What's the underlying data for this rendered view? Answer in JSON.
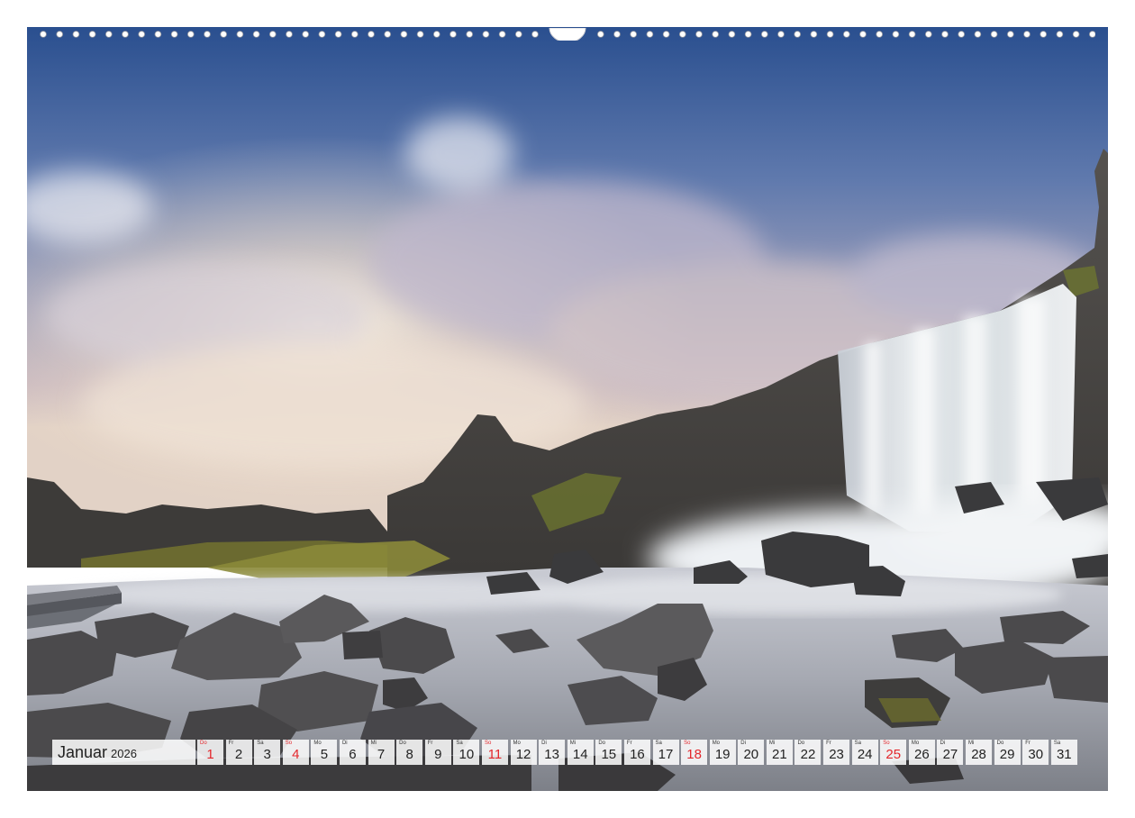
{
  "calendar": {
    "month": "Januar",
    "year": "2026",
    "sunday_color": "#e3262b",
    "days": [
      {
        "wd": "Do",
        "n": "1",
        "sun": true
      },
      {
        "wd": "Fr",
        "n": "2",
        "sun": false
      },
      {
        "wd": "Sa",
        "n": "3",
        "sun": false
      },
      {
        "wd": "So",
        "n": "4",
        "sun": true
      },
      {
        "wd": "Mo",
        "n": "5",
        "sun": false
      },
      {
        "wd": "Di",
        "n": "6",
        "sun": false
      },
      {
        "wd": "Mi",
        "n": "7",
        "sun": false
      },
      {
        "wd": "Do",
        "n": "8",
        "sun": false
      },
      {
        "wd": "Fr",
        "n": "9",
        "sun": false
      },
      {
        "wd": "Sa",
        "n": "10",
        "sun": false
      },
      {
        "wd": "So",
        "n": "11",
        "sun": true
      },
      {
        "wd": "Mo",
        "n": "12",
        "sun": false
      },
      {
        "wd": "Di",
        "n": "13",
        "sun": false
      },
      {
        "wd": "Mi",
        "n": "14",
        "sun": false
      },
      {
        "wd": "Do",
        "n": "15",
        "sun": false
      },
      {
        "wd": "Fr",
        "n": "16",
        "sun": false
      },
      {
        "wd": "Sa",
        "n": "17",
        "sun": false
      },
      {
        "wd": "So",
        "n": "18",
        "sun": true
      },
      {
        "wd": "Mo",
        "n": "19",
        "sun": false
      },
      {
        "wd": "Di",
        "n": "20",
        "sun": false
      },
      {
        "wd": "Mi",
        "n": "21",
        "sun": false
      },
      {
        "wd": "Do",
        "n": "22",
        "sun": false
      },
      {
        "wd": "Fr",
        "n": "23",
        "sun": false
      },
      {
        "wd": "Sa",
        "n": "24",
        "sun": false
      },
      {
        "wd": "So",
        "n": "25",
        "sun": true
      },
      {
        "wd": "Mo",
        "n": "26",
        "sun": false
      },
      {
        "wd": "Di",
        "n": "27",
        "sun": false
      },
      {
        "wd": "Mi",
        "n": "28",
        "sun": false
      },
      {
        "wd": "Do",
        "n": "29",
        "sun": false
      },
      {
        "wd": "Fr",
        "n": "30",
        "sun": false
      },
      {
        "wd": "Sa",
        "n": "31",
        "sun": false
      }
    ]
  }
}
